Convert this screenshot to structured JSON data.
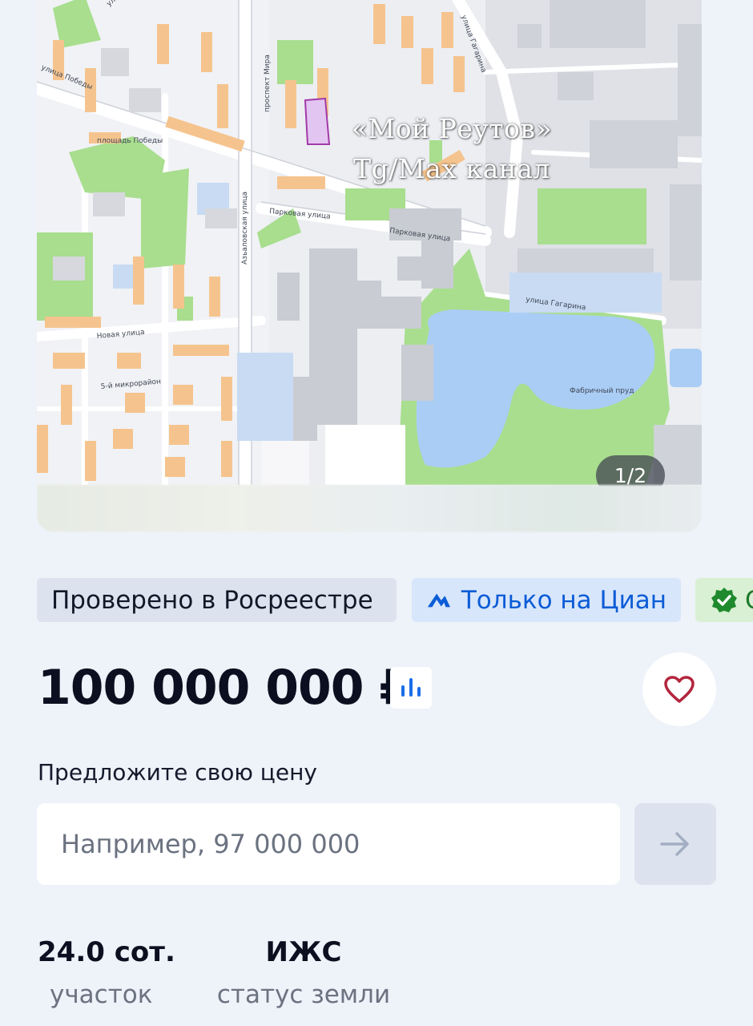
{
  "map": {
    "watermark_line1": "«Мой Реутов»",
    "watermark_line2": "Tg/Max канал",
    "photo_counter": "1/2",
    "street_labels": {
      "pobedy": "улица Победы",
      "gagarina_top": "улица Гагарина",
      "mira": "проспект Мира",
      "parkovaya_1": "Парковая улица",
      "parkovaya_2": "Парковая улица",
      "gagarina": "улица Гагарина",
      "akademicheskaya": "Азьаловская улица",
      "novaya": "Новая улица",
      "mikrorayon": "5-й микрорайон",
      "ploshchad": "площадь Победы",
      "prud": "Фабричный пруд"
    }
  },
  "badges": {
    "verified": "Проверено в Росреестре",
    "only_cian": "Только на Циан",
    "third_partial": "С"
  },
  "price": {
    "value": "100 000 000 ₽"
  },
  "offer": {
    "label": "Предложите свою цену",
    "placeholder": "Например, 97 000 000"
  },
  "facts": [
    {
      "value": "24.0 сот.",
      "label": "участок"
    },
    {
      "value": "ИЖС",
      "label": "статус земли"
    }
  ],
  "colors": {
    "accent_blue": "#0b5cd6",
    "heart_red": "#b3263e",
    "park_green": "#a8de8e",
    "water_blue": "#aacdf5",
    "building_orange": "#f5c48e"
  }
}
